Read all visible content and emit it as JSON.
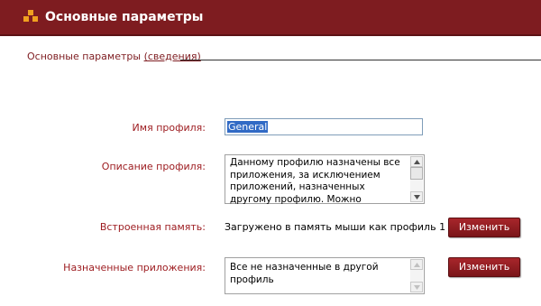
{
  "header": {
    "title": "Основные параметры",
    "icon": "settings-blocks-icon"
  },
  "section": {
    "title": "Основные параметры",
    "link": "(сведения)"
  },
  "form": {
    "profile_name": {
      "label": "Имя профиля:",
      "value": "General"
    },
    "profile_description": {
      "label": "Описание профиля:",
      "value": "Данному профилю назначены все приложения, за исключением приложений, назначенных другому профилю. Можно изменить, но нельзя"
    },
    "onboard_memory": {
      "label": "Встроенная память:",
      "value": "Загружено в память мыши как профиль 1",
      "button": "Изменить"
    },
    "assigned_apps": {
      "label": "Назначенные приложения:",
      "value": "Все не назначенные в другой профиль",
      "button": "Изменить"
    }
  },
  "colors": {
    "titlebar": "#7e1c20",
    "label": "#9c1a1e",
    "button": "#8e1d22"
  }
}
